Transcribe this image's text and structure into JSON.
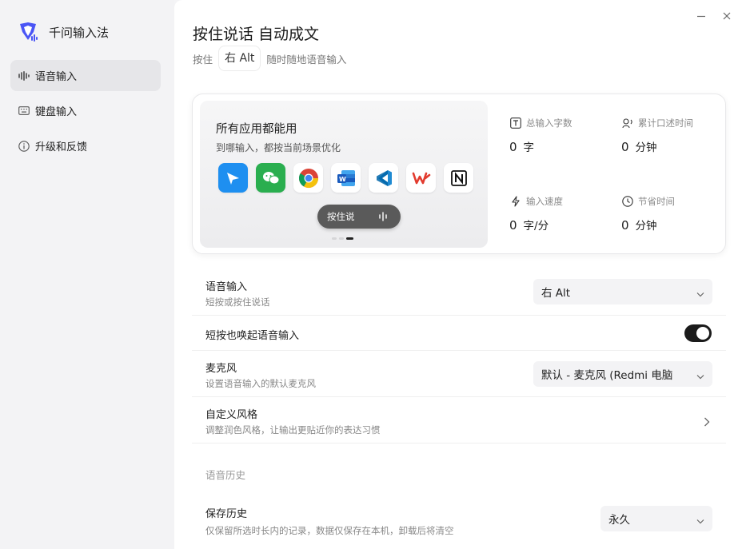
{
  "app": {
    "name": "千问输入法",
    "brand_color": "#4a55f5"
  },
  "sidebar": {
    "items": [
      {
        "label": "语音输入",
        "icon": "waveform-icon",
        "active": true
      },
      {
        "label": "键盘输入",
        "icon": "keyboard-icon",
        "active": false
      },
      {
        "label": "升级和反馈",
        "icon": "info-icon",
        "active": false
      }
    ]
  },
  "window": {
    "minimize": "minimize-icon",
    "close": "close-icon"
  },
  "header": {
    "title": "按住说话 自动成文",
    "prefix": "按住",
    "key": "右 Alt",
    "suffix": "随时随地语音输入"
  },
  "promo": {
    "title": "所有应用都能用",
    "subtitle": "到哪输入，都按当前场景优化",
    "apps": [
      "feishu-icon",
      "wechat-icon",
      "chrome-icon",
      "word-icon",
      "vscode-icon",
      "wps-icon",
      "notion-icon"
    ],
    "pill_label": "按住说",
    "carousel_active_index": 2
  },
  "stats": {
    "total_chars": {
      "label": "总输入字数",
      "value": "0",
      "unit": "字",
      "icon": "text-icon"
    },
    "dictation_time": {
      "label": "累计口述时间",
      "value": "0",
      "unit": "分钟",
      "icon": "speaker-icon"
    },
    "input_speed": {
      "label": "输入速度",
      "value": "0",
      "unit": "字/分",
      "icon": "lightning-icon"
    },
    "time_saved": {
      "label": "节省时间",
      "value": "0",
      "unit": "分钟",
      "icon": "clock-icon"
    }
  },
  "settings": {
    "voice_input": {
      "title": "语音输入",
      "subtitle": "短按或按住说话",
      "value": "右 Alt"
    },
    "short_press": {
      "title": "短按也唤起语音输入",
      "enabled": true
    },
    "microphone": {
      "title": "麦克风",
      "subtitle": "设置语音输入的默认麦克风",
      "value": "默认 - 麦克风 (Redmi 电脑"
    },
    "custom_style": {
      "title": "自定义风格",
      "subtitle": "调整润色风格，让输出更贴近你的表达习惯"
    },
    "history_section": "语音历史",
    "save_history": {
      "title": "保存历史",
      "subtitle": "仅保留所选时长内的记录，数据仅保存在本机，卸载后将清空",
      "value": "永久"
    }
  }
}
